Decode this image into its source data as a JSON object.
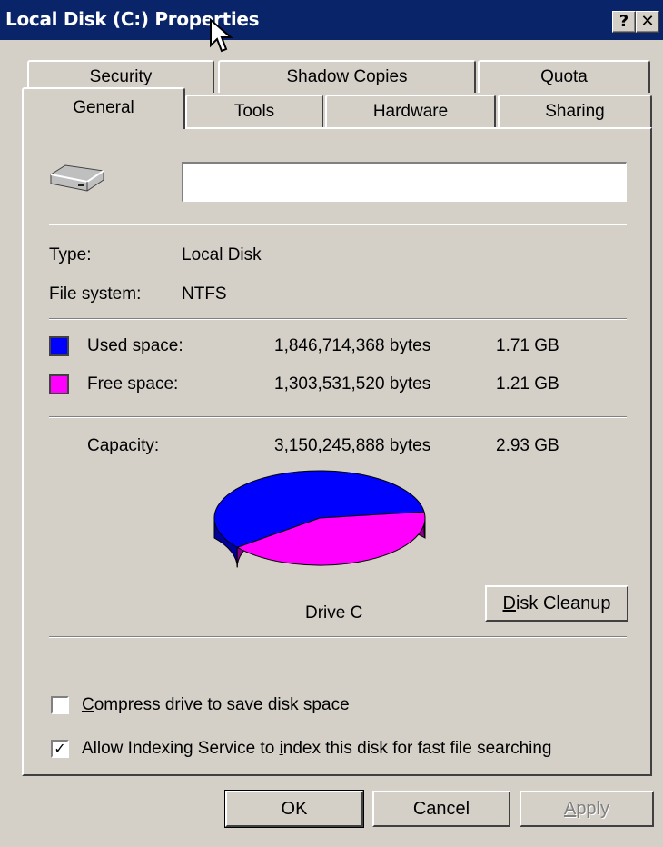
{
  "window": {
    "title": "Local Disk (C:) Properties",
    "help_label": "?",
    "close_label": "✕"
  },
  "tabs": {
    "row_back": [
      "Security",
      "Shadow Copies",
      "Quota"
    ],
    "row_front": [
      "General",
      "Tools",
      "Hardware",
      "Sharing"
    ],
    "active": "General"
  },
  "general": {
    "drive_icon": "hard-drive-icon",
    "name_value": "",
    "type_label": "Type:",
    "type_value": "Local Disk",
    "fs_label": "File system:",
    "fs_value": "NTFS",
    "used": {
      "label": "Used space:",
      "bytes": "1,846,714,368 bytes",
      "size": "1.71 GB",
      "color": "#0000ff"
    },
    "free": {
      "label": "Free space:",
      "bytes": "1,303,531,520 bytes",
      "size": "1.21 GB",
      "color": "#ff00ff"
    },
    "capacity": {
      "label": "Capacity:",
      "bytes": "3,150,245,888 bytes",
      "size": "2.93 GB"
    },
    "drive_label": "Drive C",
    "cleanup_prefix": "D",
    "cleanup_rest": "isk Cleanup",
    "compress_prefix": "C",
    "compress_rest": "ompress drive to save disk space",
    "compress_checked": false,
    "index_before": "Allow Indexing Service to ",
    "index_accel": "i",
    "index_after": "ndex this disk for fast file searching",
    "index_checked": true
  },
  "chart_data": {
    "type": "pie",
    "categories": [
      "Used space",
      "Free space"
    ],
    "values": [
      1846714368,
      1303531520
    ],
    "colors": [
      "#0000ff",
      "#ff00ff"
    ],
    "title": "Drive C"
  },
  "footer": {
    "ok": "OK",
    "cancel": "Cancel",
    "apply_prefix": "A",
    "apply_rest": "pply"
  }
}
